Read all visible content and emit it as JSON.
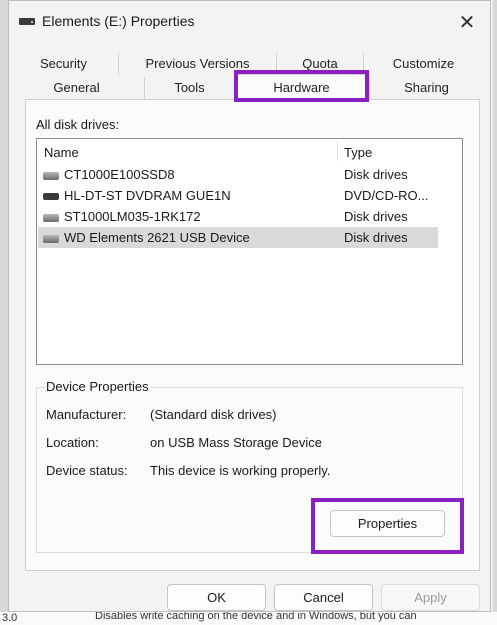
{
  "window": {
    "title": "Elements (E:) Properties",
    "close_glyph": "✕"
  },
  "tabs": {
    "row1": [
      "Security",
      "Previous Versions",
      "Quota",
      "Customize"
    ],
    "row2": [
      "General",
      "Tools",
      "Hardware",
      "Sharing"
    ],
    "active": "Hardware"
  },
  "hardware": {
    "all_drives_label": "All disk drives:",
    "columns": {
      "name": "Name",
      "type": "Type"
    },
    "drives": [
      {
        "name": "CT1000E100SSD8",
        "type": "Disk drives",
        "icon": "disk-drive-icon",
        "selected": false
      },
      {
        "name": "HL-DT-ST DVDRAM GUE1N",
        "type": "DVD/CD-RO...",
        "icon": "dvd-drive-icon",
        "selected": false
      },
      {
        "name": "ST1000LM035-1RK172",
        "type": "Disk drives",
        "icon": "disk-drive-icon",
        "selected": false
      },
      {
        "name": "WD Elements 2621 USB Device",
        "type": "Disk drives",
        "icon": "disk-drive-icon",
        "selected": true
      }
    ]
  },
  "device_properties": {
    "group_title": "Device Properties",
    "manufacturer_label": "Manufacturer:",
    "manufacturer_value": "(Standard disk drives)",
    "location_label": "Location:",
    "location_value": "on USB Mass Storage Device",
    "status_label": "Device status:",
    "status_value": "This device is working properly.",
    "properties_button": "Properties"
  },
  "footer": {
    "ok": "OK",
    "cancel": "Cancel",
    "apply": "Apply"
  },
  "background": {
    "bottom_left": "3.0",
    "bottom_text": "Disables write caching on the device and in Windows, but you can"
  },
  "colors": {
    "highlight": "#8a1fc4",
    "selected_row": "#d9d9d9"
  }
}
